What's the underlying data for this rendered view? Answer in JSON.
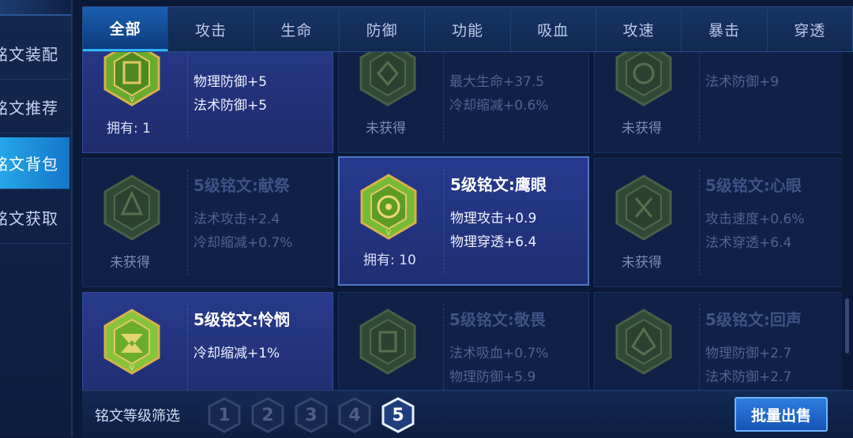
{
  "sidebar": {
    "items": [
      {
        "label": "铭文装配",
        "active": false
      },
      {
        "label": "铭文推荐",
        "active": false
      },
      {
        "label": "铭文背包",
        "active": true
      },
      {
        "label": "铭文获取",
        "active": false
      }
    ]
  },
  "tabs": [
    {
      "label": "全部",
      "active": true
    },
    {
      "label": "攻击",
      "active": false
    },
    {
      "label": "生命",
      "active": false
    },
    {
      "label": "防御",
      "active": false
    },
    {
      "label": "功能",
      "active": false
    },
    {
      "label": "吸血",
      "active": false
    },
    {
      "label": "攻速",
      "active": false
    },
    {
      "label": "暴击",
      "active": false
    },
    {
      "label": "穿透",
      "active": false
    }
  ],
  "cards": [
    {
      "title": "",
      "stats": [
        "物理防御+5",
        "法术防御+5"
      ],
      "owned_label": "拥有: 1",
      "owned": true,
      "icon": "defense-rune-icon",
      "color": "#7bbf3a"
    },
    {
      "title": "",
      "stats": [
        "最大生命+37.5",
        "冷却缩减+0.6%"
      ],
      "owned_label": "未获得",
      "owned": false,
      "icon": "life-rune-icon",
      "color": "#3f6a3a"
    },
    {
      "title": "",
      "stats": [
        "法术防御+9"
      ],
      "owned_label": "未获得",
      "owned": false,
      "icon": "magic-defense-rune-icon",
      "color": "#3f6a3a"
    },
    {
      "title": "5级铭文:献祭",
      "stats": [
        "法术攻击+2.4",
        "冷却缩减+0.7%"
      ],
      "owned_label": "未获得",
      "owned": false,
      "icon": "sacrifice-rune-icon",
      "color": "#3f6a3a"
    },
    {
      "title": "5级铭文:鹰眼",
      "stats": [
        "物理攻击+0.9",
        "物理穿透+6.4"
      ],
      "owned_label": "拥有: 10",
      "owned": true,
      "icon": "hawkeye-rune-icon",
      "color": "#7bbf3a"
    },
    {
      "title": "5级铭文:心眼",
      "stats": [
        "攻击速度+0.6%",
        "法术穿透+6.4"
      ],
      "owned_label": "未获得",
      "owned": false,
      "icon": "mind-eye-rune-icon",
      "color": "#3f6a3a"
    },
    {
      "title": "5级铭文:怜悯",
      "stats": [
        "冷却缩减+1%"
      ],
      "owned_label": "",
      "owned": true,
      "icon": "mercy-rune-icon",
      "color": "#7bbf3a"
    },
    {
      "title": "5级铭文:敬畏",
      "stats": [
        "法术吸血+0.7%",
        "物理防御+5.9"
      ],
      "owned_label": "",
      "owned": false,
      "icon": "awe-rune-icon",
      "color": "#3f6a3a"
    },
    {
      "title": "5级铭文:回声",
      "stats": [
        "物理防御+2.7",
        "法术防御+2.7"
      ],
      "owned_label": "",
      "owned": false,
      "icon": "echo-rune-icon",
      "color": "#3f6a3a"
    }
  ],
  "filter": {
    "label": "铭文等级筛选",
    "levels": [
      "1",
      "2",
      "3",
      "4",
      "5"
    ],
    "active_level": "5"
  },
  "sell_button": "批量出售",
  "colors": {
    "accent": "#2fb4ff",
    "rune_green": "#7bbf3a",
    "gold": "#d7b24a"
  }
}
